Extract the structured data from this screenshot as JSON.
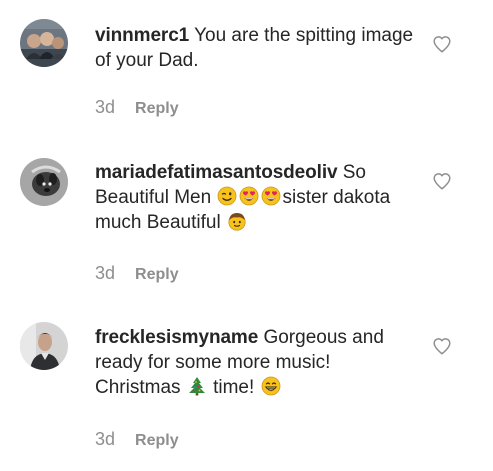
{
  "comments": [
    {
      "username": "vinnmerc1",
      "text": " You are the spitting image of your Dad.",
      "time": "3d",
      "reply_label": "Reply"
    },
    {
      "username": "mariadefatimasantosdeoliv",
      "text_a": " So Beautiful Men ",
      "text_b": "sister dakota much Beautiful ",
      "time": "3d",
      "reply_label": "Reply",
      "emojis": [
        "winking-face-emoji",
        "heart-eyes-emoji",
        "heart-eyes-emoji",
        "boy-face-emoji"
      ]
    },
    {
      "username": "frecklesismyname",
      "text_a": " Gorgeous and ready for some more music! Christmas ",
      "text_b": " time! ",
      "time": "3d",
      "reply_label": "Reply",
      "emojis": [
        "christmas-tree-emoji",
        "grinning-face-emoji"
      ]
    }
  ],
  "colors": {
    "text": "#262626",
    "muted": "#8e8e8e",
    "emoji_yellow": "#f7c21b",
    "heart_red": "#e0245e",
    "tree_green": "#2e8b3a"
  },
  "icons": {
    "like": "heart-outline-icon"
  }
}
